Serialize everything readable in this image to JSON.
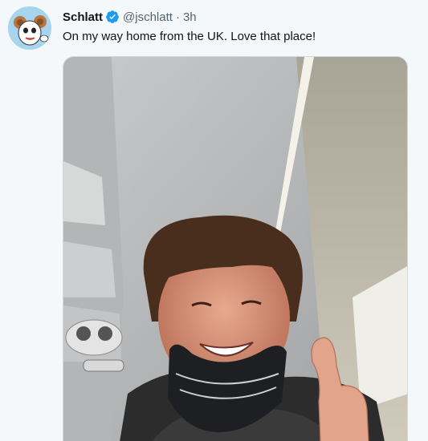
{
  "tweet": {
    "author_name": "Schlatt",
    "handle": "@jschlatt",
    "separator": "·",
    "time": "3h",
    "text": "On my way home from the UK. Love that place!",
    "verified_color": "#1d9bf0"
  },
  "icons": {
    "verified": "verified-badge-icon"
  },
  "media": {
    "description_icon": "photo"
  }
}
